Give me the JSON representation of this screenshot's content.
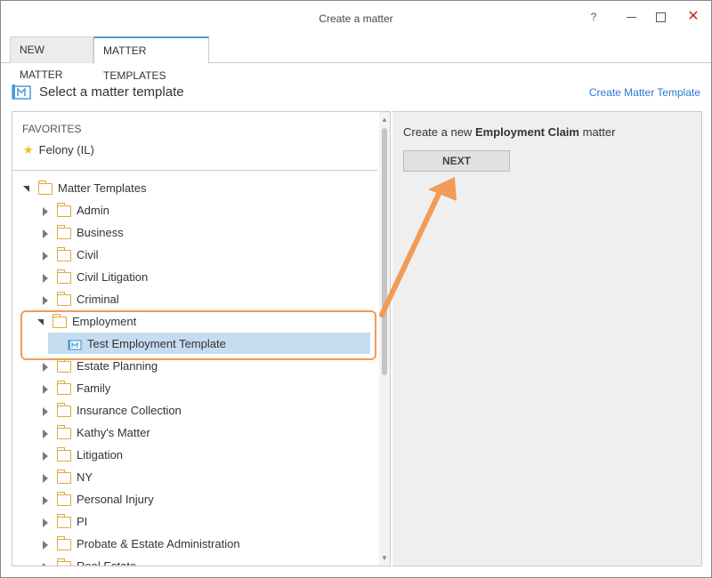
{
  "window": {
    "title": "Create a matter",
    "help_label": "?",
    "close_label": "✕"
  },
  "tabs": [
    {
      "label": "NEW MATTER"
    },
    {
      "label": "MATTER TEMPLATES"
    }
  ],
  "toolbar": {
    "heading": "Select a matter template",
    "create_link": "Create Matter Template"
  },
  "favorites": {
    "header": "FAVORITES",
    "items": [
      {
        "label": "Felony (IL)"
      }
    ]
  },
  "tree": {
    "root_label": "Matter Templates",
    "folders": [
      {
        "label": "Admin"
      },
      {
        "label": "Business"
      },
      {
        "label": "Civil"
      },
      {
        "label": "Civil Litigation"
      },
      {
        "label": "Criminal"
      },
      {
        "label": "Employment"
      },
      {
        "label": "Estate Planning"
      },
      {
        "label": "Family"
      },
      {
        "label": "Insurance Collection"
      },
      {
        "label": "Kathy's Matter"
      },
      {
        "label": "Litigation"
      },
      {
        "label": "NY"
      },
      {
        "label": "Personal Injury"
      },
      {
        "label": "PI"
      },
      {
        "label": "Probate & Estate Administration"
      },
      {
        "label": "Real Estate"
      }
    ],
    "selected_template": "Test Employment Template"
  },
  "right_panel": {
    "prefix": "Create a new",
    "matter_type": "Employment Claim",
    "suffix": "matter",
    "next_label": "NEXT"
  },
  "colors": {
    "accent": "#4a9bd6",
    "link": "#2a7ad0",
    "highlight": "#f29b56",
    "selected_row": "#c6dcf1",
    "folder": "#e0a83a"
  }
}
